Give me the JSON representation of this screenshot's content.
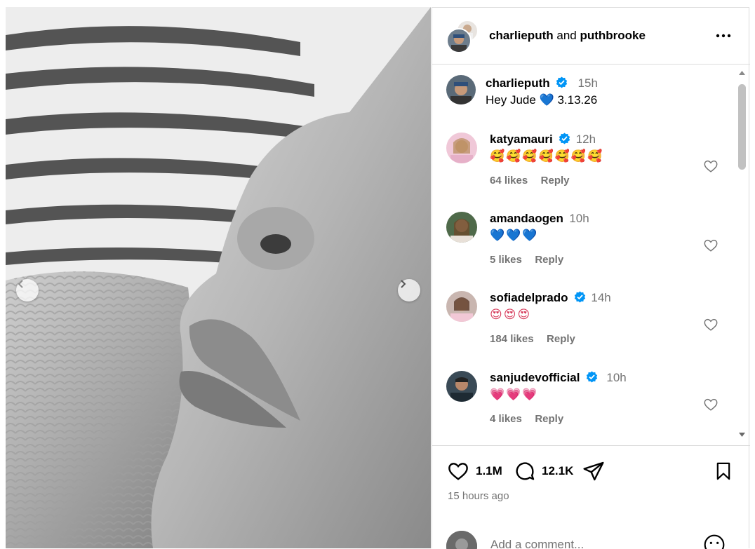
{
  "post": {
    "header": {
      "user1": "charlieputh",
      "joiner": "and",
      "user2": "puthbrooke",
      "more_icon": "more-horizontal-icon"
    },
    "caption": {
      "username": "charlieputh",
      "time": "15h",
      "text_before": "Hey Jude",
      "emoji": "💙",
      "text_after": "3.13.26"
    },
    "comments": [
      {
        "username": "katyamauri",
        "verified": true,
        "time": "12h",
        "text": "🥰🥰🥰🥰🥰🥰🥰",
        "likes": "64 likes",
        "reply": "Reply"
      },
      {
        "username": "amandaogen",
        "verified": false,
        "time": "10h",
        "text": "💙💙💙",
        "likes": "5 likes",
        "reply": "Reply"
      },
      {
        "username": "sofiadelprado",
        "verified": true,
        "time": "14h",
        "text": "😍😍😍",
        "likes": "184 likes",
        "reply": "Reply"
      },
      {
        "username": "sanjudevofficial",
        "verified": true,
        "time": "10h",
        "text": "💗💗💗",
        "likes": "4 likes",
        "reply": "Reply"
      }
    ],
    "actions": {
      "like_count": "1.1M",
      "comment_count": "12.1K",
      "posted": "15 hours ago"
    },
    "add_comment": {
      "placeholder": "Add a comment..."
    }
  },
  "colors": {
    "verified": "#0095f6",
    "border": "#dbdbdb",
    "muted": "#737373"
  }
}
